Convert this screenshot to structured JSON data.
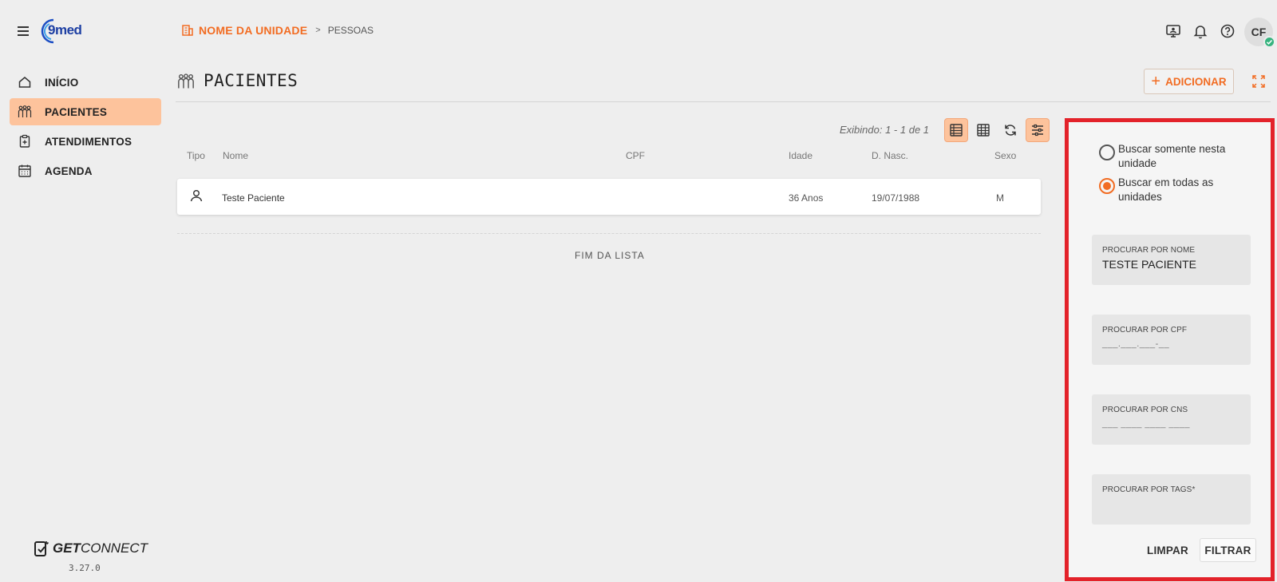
{
  "header": {
    "unit_name": "NOME DA UNIDADE",
    "separator": ">",
    "page": "PESSOAS",
    "avatar_initials": "CF"
  },
  "logo": {
    "text": "9med"
  },
  "sidebar": {
    "items": [
      {
        "label": "INÍCIO",
        "icon": "home-icon",
        "active": false
      },
      {
        "label": "PACIENTES",
        "icon": "patients-icon",
        "active": true
      },
      {
        "label": "ATENDIMENTOS",
        "icon": "clipboard-icon",
        "active": false
      },
      {
        "label": "AGENDA",
        "icon": "calendar-icon",
        "active": false
      }
    ],
    "brand_bold": "GET",
    "brand_light": "CONNECT",
    "version": "3.27.0"
  },
  "main": {
    "title": "PACIENTES",
    "add_label": "ADICIONAR",
    "showing": "Exibindo: 1 - 1 de 1",
    "columns": [
      "Tipo",
      "Nome",
      "CPF",
      "Idade",
      "D. Nasc.",
      "Sexo"
    ],
    "rows": [
      {
        "type_icon": "person-icon",
        "nome": "Teste Paciente",
        "cpf": "",
        "idade": "36 Anos",
        "nasc": "19/07/1988",
        "sexo": "M"
      }
    ],
    "end_of_list": "FIM DA LISTA"
  },
  "filter": {
    "radio_unit": "Buscar somente nesta unidade",
    "radio_all": "Buscar em todas as unidades",
    "selected": "all",
    "name_label": "PROCURAR POR NOME",
    "name_value": "TESTE PACIENTE",
    "cpf_label": "PROCURAR POR CPF",
    "cpf_mask": "___.___.___-__",
    "cns_label": "PROCURAR POR CNS",
    "cns_mask": "___ ____ ____ ____",
    "tags_label": "PROCURAR POR TAGS*",
    "clear_label": "LIMPAR",
    "filter_label": "FILTRAR"
  },
  "colors": {
    "accent": "#f26c22",
    "active_bg": "#fdc39c",
    "highlight_border": "#e3222a",
    "online": "#36b37e"
  }
}
